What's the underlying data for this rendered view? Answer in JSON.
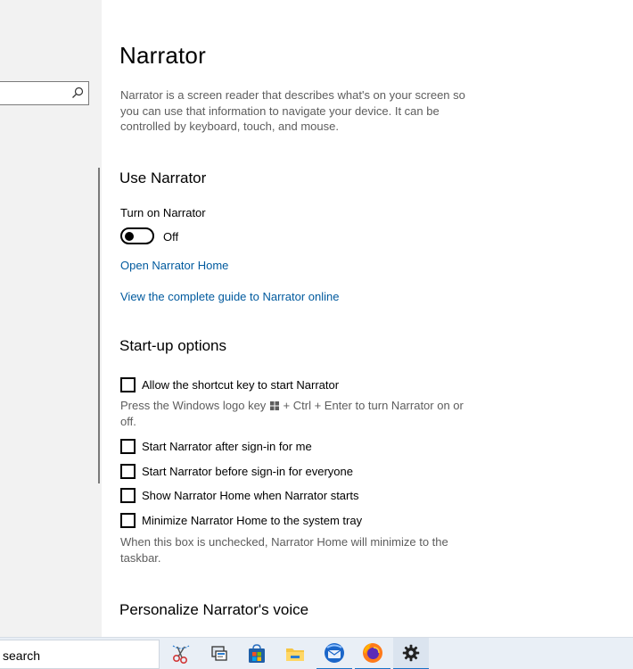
{
  "page": {
    "title": "Narrator",
    "description": "Narrator is a screen reader that describes what's on your screen so you can use that information to navigate your device. It can be controlled by keyboard, touch, and mouse."
  },
  "use_narrator": {
    "heading": "Use Narrator",
    "toggle_label": "Turn on Narrator",
    "toggle_state": "Off",
    "toggle_on": false,
    "link_home": "Open Narrator Home",
    "link_guide": "View the complete guide to Narrator online"
  },
  "startup": {
    "heading": "Start-up options",
    "shortcut_label": "Allow the shortcut key to start Narrator",
    "shortcut_help_before": "Press the Windows logo key",
    "shortcut_help_after": "+ Ctrl + Enter to turn Narrator on or off.",
    "after_signin_label": "Start Narrator after sign-in for me",
    "before_signin_label": "Start Narrator before sign-in for everyone",
    "show_home_label": "Show Narrator Home when Narrator starts",
    "minimize_label": "Minimize Narrator Home to the system tray",
    "minimize_help": "When this box is unchecked, Narrator Home will minimize to the taskbar."
  },
  "voice": {
    "heading": "Personalize Narrator's voice"
  },
  "taskbar": {
    "search_text": "search",
    "apps": [
      {
        "icon": "snipping-tool-icon"
      },
      {
        "icon": "task-view-icon"
      },
      {
        "icon": "store-icon"
      },
      {
        "icon": "file-explorer-icon"
      },
      {
        "icon": "thunderbird-icon"
      },
      {
        "icon": "firefox-icon"
      },
      {
        "icon": "settings-gear-icon"
      }
    ]
  },
  "colors": {
    "link": "#005a9e",
    "secondary_text": "#5d5d5d",
    "nav_background": "#f2f2f2",
    "taskbar_background": "#e9eff6",
    "taskbar_accent": "#1a73c5"
  }
}
